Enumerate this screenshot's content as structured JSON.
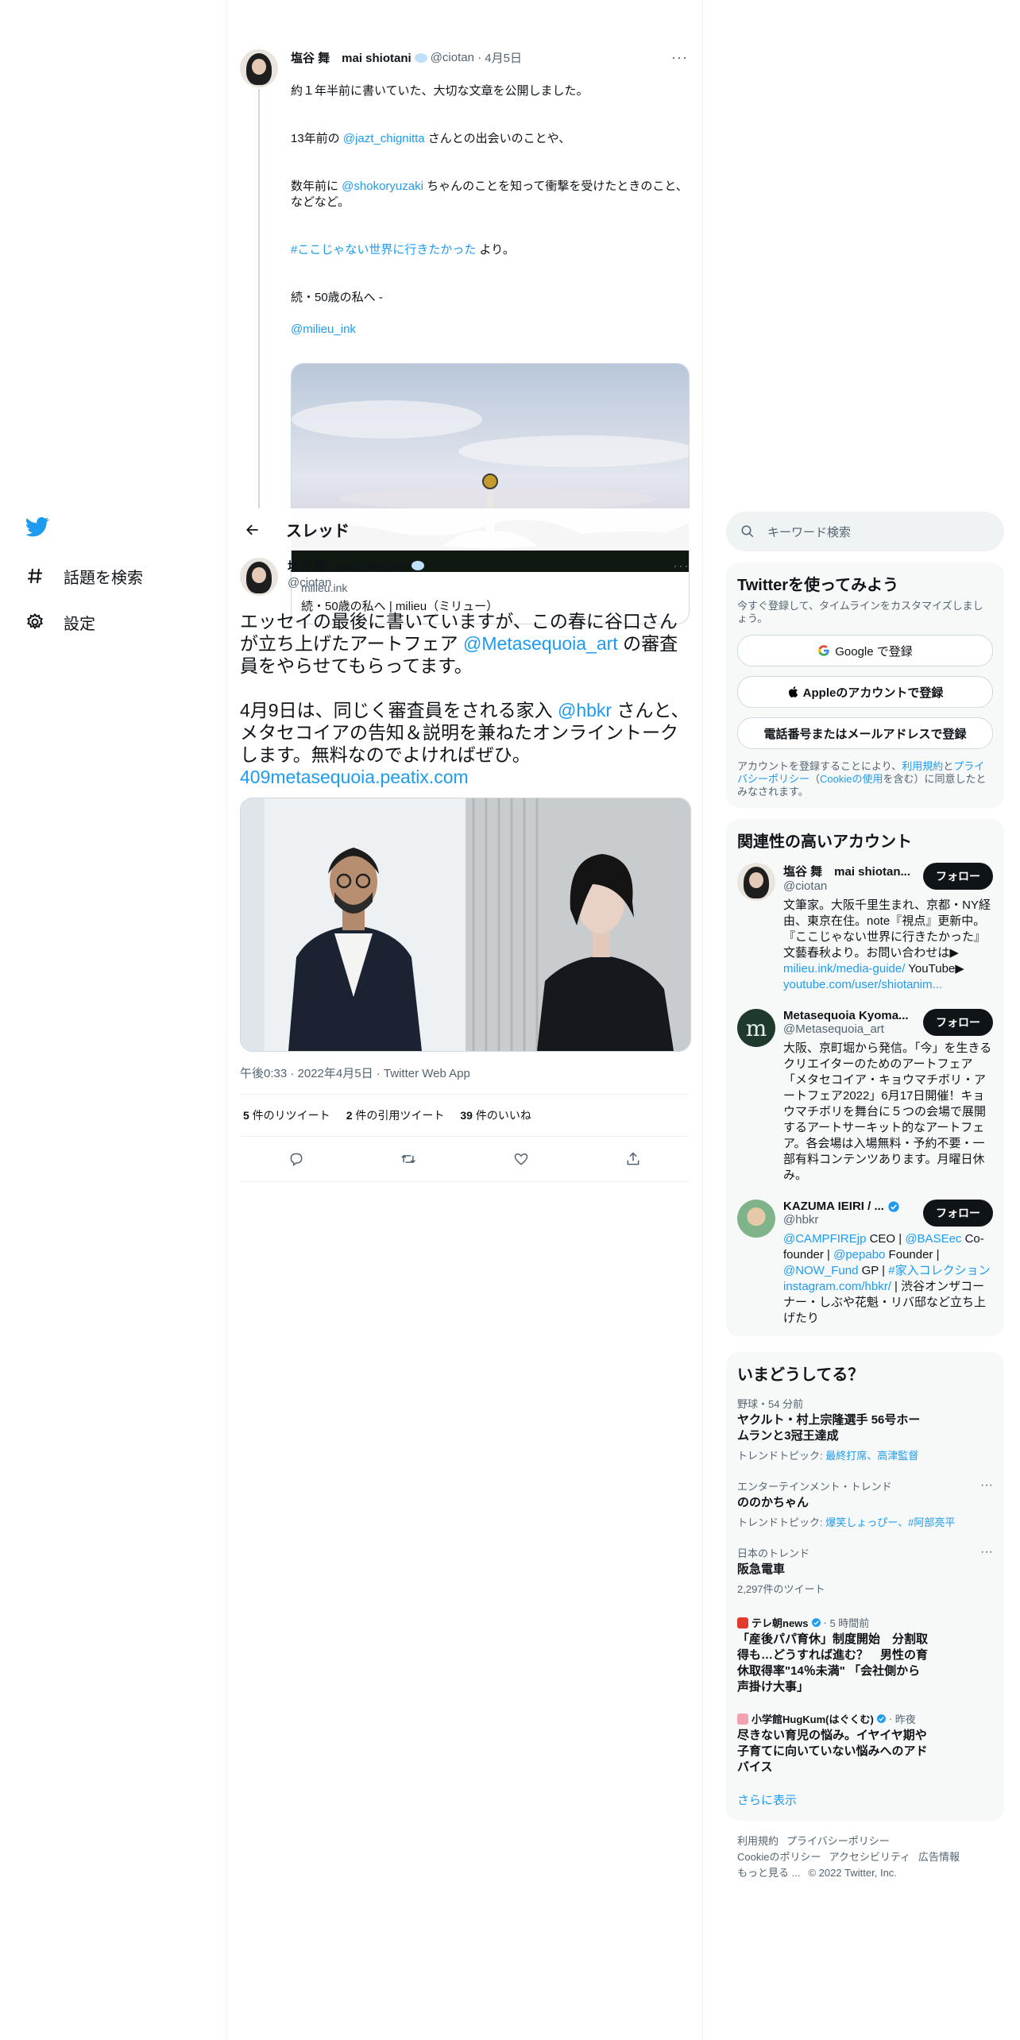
{
  "nav": {
    "items": [
      {
        "label": "話題を検索",
        "icon": "hashtag-icon"
      },
      {
        "label": "設定",
        "icon": "gear-icon"
      }
    ]
  },
  "prev_tweet": {
    "name": "塩谷 舞　mai shiotani",
    "handle": "@ciotan",
    "date": "4月5日",
    "text_line1": "約１年半前に書いていた、大切な文章を公開しました。",
    "p2_pre": "13年前の ",
    "p2_link": "@jazt_chignitta",
    "p2_post": " さんとの出会いのことや、",
    "p3_pre": "数年前に ",
    "p3_link": "@shokoryuzaki",
    "p3_post": " ちゃんのことを知って衝撃を受けたときのこと、などなど。",
    "p4_link": "#ここじゃない世界に行きたかった",
    "p4_post": " より。",
    "p5": "続・50歳の私へ -",
    "p5_link": "@milieu_ink",
    "card": {
      "domain": "milieu.ink",
      "title": "続・50歳の私へ | milieu（ミリュー）"
    }
  },
  "header": {
    "title": "スレッド"
  },
  "main_tweet": {
    "name": "塩谷 舞　mai shiotani",
    "handle": "@ciotan",
    "t1": "エッセイの最後に書いていますが、この春に谷口さんが立ち上げたアートフェア ",
    "t1_link": "@Metasequoia_art",
    "t1_post": " の審査員をやらせてもらってます。",
    "t2": "4月9日は、同じく審査員をされる家入 ",
    "t2_link": "@hbkr",
    "t2_post": " さんと、メタセコイアの告知＆説明を兼ねたオンライントークします。無料なのでよければぜひ。",
    "t3_link": "409metasequoia.peatix.com",
    "meta": "午後0:33 · 2022年4月5日 · Twitter Web App",
    "stats": [
      {
        "num": "5",
        "label": " 件のリツイート"
      },
      {
        "num": "2",
        "label": " 件の引用ツイート"
      },
      {
        "num": "39",
        "label": " 件のいいね"
      }
    ]
  },
  "search": {
    "placeholder": "キーワード検索"
  },
  "signup": {
    "title": "Twitterを使ってみよう",
    "subtitle": "今すぐ登録して、タイムラインをカスタマイズしましょう。",
    "google": "Google で登録",
    "apple": "Appleのアカウントで登録",
    "phone": "電話番号またはメールアドレスで登録",
    "terms_pre": "アカウントを登録することにより、",
    "terms_link1": "利用規約",
    "terms_mid1": "と",
    "terms_link2": "プライバシーポリシー",
    "terms_mid2": "（",
    "terms_link3": "Cookieの使用",
    "terms_post": "を含む）に同意したとみなされます。"
  },
  "related": {
    "title": "関連性の高いアカウント",
    "follow_label": "フォロー",
    "accounts": [
      {
        "name": "塩谷 舞　mai shiotan...",
        "handle": "@ciotan",
        "bio": "文筆家。大阪千里生まれ、京都・NY経由、東京在住。note『視点』更新中。『ここじゃない世界に行きたかった』文藝春秋より。お問い合わせは▶",
        "bio_link1": "milieu.ink/media-guide/",
        "bio_mid": " YouTube▶",
        "bio_link2": "youtube.com/user/shiotanim..."
      },
      {
        "name": "Metasequoia Kyoma...",
        "handle": "@Metasequoia_art",
        "bio": "大阪、京町堀から発信。「今」を生きるクリエイターのためのアートフェア「メタセコイア・キョウマチボリ・アートフェア2022」6月17日開催！キョウマチボリを舞台に５つの会場で展開するアートサーキット的なアートフェア。各会場は入場無料・予約不要・一部有料コンテンツあります。月曜日休み。"
      },
      {
        "name": "KAZUMA IEIRI / ...",
        "handle": "@hbkr",
        "bio_l1": "@CAMPFIREjp",
        "bio_t1": " CEO | ",
        "bio_l2": "@BASEec",
        "bio_t2": " Co-founder | ",
        "bio_l3": "@pepabo",
        "bio_t3": " Founder | ",
        "bio_l4": "@NOW_Fund",
        "bio_t4": " GP | ",
        "bio_l5": "#家入コレクション",
        "bio_t5": " ",
        "bio_l6": "instagram.com/hbkr/",
        "bio_t6": " | 渋谷オンザコーナー・しぶや花魁・リバ邸など立ち上げたり"
      }
    ]
  },
  "trends": {
    "title": "いまどうしてる？",
    "items": [
      {
        "cat": "野球・54 分前",
        "title": "ヤクルト・村上宗隆選手 56号ホームランと3冠王達成",
        "sub_pre": "トレンドトピック: ",
        "sub_links": "最終打席、高津監督"
      },
      {
        "cat": "エンターテインメント・トレンド",
        "title": "ののかちゃん",
        "sub_pre": "トレンドトピック: ",
        "sub_links": "爆笑しょっぴー、#阿部亮平"
      },
      {
        "cat": "日本のトレンド",
        "title": "阪急電車",
        "sub": "2,297件のツイート"
      }
    ],
    "news": [
      {
        "source": "テレ朝news",
        "time": "5 時間前",
        "title": "「産後パパ育休」制度開始　分割取得も…どうすれば進む？　男性の育休取得率\"14％未満\" 「会社側から声掛け大事」"
      },
      {
        "source": "小学館HugKum(はぐくむ)",
        "time": "昨夜",
        "title": "尽きない育児の悩み。イヤイヤ期や子育てに向いていない悩みへのアドバイス"
      }
    ],
    "show_more": "さらに表示"
  },
  "footer": {
    "links": [
      "利用規約",
      "プライバシーポリシー",
      "Cookieのポリシー",
      "アクセシビリティ",
      "広告情報",
      "もっと見る ..."
    ],
    "copyright": "© 2022 Twitter, Inc."
  },
  "colors": {
    "accent": "#1d9bf0",
    "text": "#0f1419",
    "muted": "#536471",
    "panel": "#f7f9f9"
  }
}
